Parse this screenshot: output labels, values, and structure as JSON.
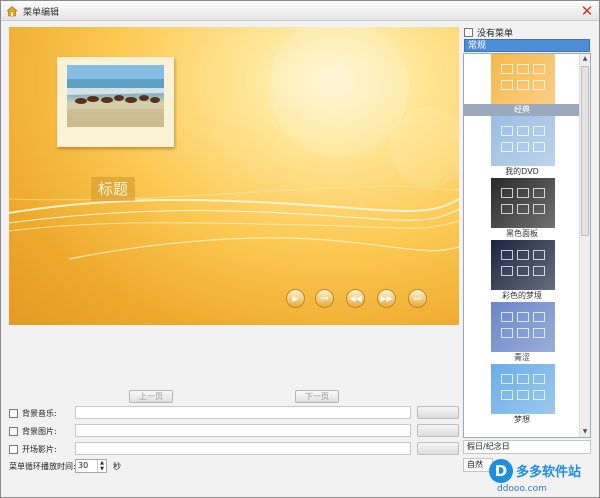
{
  "window": {
    "title": "菜单编辑",
    "close_icon": "close-icon"
  },
  "preview": {
    "title_text": "标题",
    "nav_buttons": [
      {
        "name": "play-icon",
        "glyph": "▶"
      },
      {
        "name": "skip-back-icon",
        "glyph": "⏮"
      },
      {
        "name": "rewind-icon",
        "glyph": "◀◀"
      },
      {
        "name": "fast-forward-icon",
        "glyph": "▶▶"
      },
      {
        "name": "skip-forward-icon",
        "glyph": "⏭"
      }
    ]
  },
  "side_panel": {
    "no_menu_label": "没有菜单",
    "no_menu_checked": false,
    "category": "常规",
    "themes": [
      {
        "label": "经典",
        "selected": true,
        "bg": "#f5b74a"
      },
      {
        "label": "我的DVD",
        "selected": false,
        "bg": "#9bbde2"
      },
      {
        "label": "黑色面板",
        "selected": false,
        "bg": "#2a2a2a"
      },
      {
        "label": "彩色的梦境",
        "selected": false,
        "bg": "#1a2540"
      },
      {
        "label": "青涩",
        "selected": false,
        "bg": "#6a86c8"
      },
      {
        "label": "梦想",
        "selected": false,
        "bg": "#6aaee6"
      }
    ],
    "holiday_button": "假日/纪念日",
    "nature_button": "自然"
  },
  "bottom": {
    "prev_page_button": "上一页",
    "next_page_button": "下一页",
    "bg_music_label": "背景音乐:",
    "bg_image_label": "背景图片:",
    "intro_video_label": "开场影片:",
    "browse_label": "",
    "loop_label": "菜单循环播放时间:",
    "loop_value": "30",
    "seconds_label": "秒"
  },
  "watermark": {
    "logo": "D",
    "name": "多多软件站",
    "url": "ddooo.com"
  }
}
